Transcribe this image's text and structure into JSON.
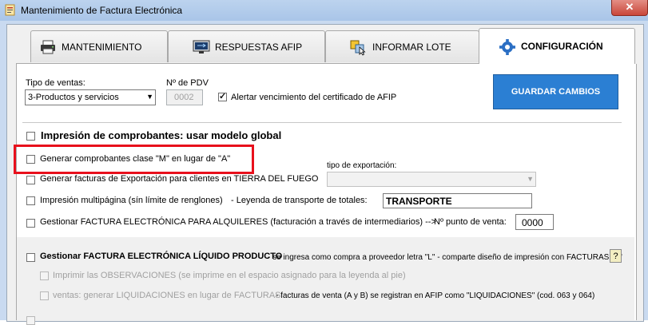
{
  "window": {
    "title": "Mantenimiento de Factura Electrónica",
    "close_label": "✕"
  },
  "tabs": [
    {
      "label": "MANTENIMIENTO",
      "icon": "printer-icon"
    },
    {
      "label": "RESPUESTAS AFIP",
      "icon": "monitor-icon"
    },
    {
      "label": "INFORMAR LOTE",
      "icon": "window-cursor-icon"
    },
    {
      "label": "CONFIGURACIÓN",
      "icon": "gear-icon",
      "active": true
    }
  ],
  "config": {
    "tipo_ventas_label": "Tipo de ventas:",
    "tipo_ventas_value": "3-Productos y servicios",
    "pdv_label": "Nº de PDV",
    "pdv_value": "0002",
    "alertar_label": "Alertar vencimiento del certificado de AFIP",
    "alertar_checked": true,
    "save_label": "GUARDAR CAMBIOS",
    "impresion_global_label": "Impresión de comprobantes: usar modelo global",
    "clase_m_label": "Generar comprobantes clase \"M\" en lugar de \"A\"",
    "exportacion_label": "Generar facturas de Exportación para clientes en TIERRA DEL FUEGO",
    "tipo_exportacion_label": "tipo de exportación:",
    "tipo_exportacion_value": "",
    "multipagina_label": "Impresión multipágina (sín límite de renglones)",
    "leyenda_label": "-  Leyenda de transporte de totales:",
    "leyenda_value": "TRANSPORTE",
    "alquileres_label": "Gestionar FACTURA ELECTRÓNICA PARA ALQUILERES (facturación a través de intermediarios)  -->",
    "punto_venta_label": "Nº punto de venta:",
    "punto_venta_value": "0000",
    "liquido_label": "Gestionar FACTURA ELECTRÓNICA LÍQUIDO PRODUCTO",
    "liquido_desc": "-  se ingresa como compra a proveedor letra \"L\" - comparte diseño de impresión con FACTURAS \"A\"",
    "help_label": "?",
    "observaciones_label": "Imprimir las OBSERVACIONES (se imprime en el espacio asignado para la leyenda al pie)",
    "liquidaciones_label": "ventas: generar LIQUIDACIONES en lugar de FACTURAS",
    "liquidaciones_desc": "-  facturas de venta (A y B) se registran en AFIP como \"LIQUIDACIONES\" (cod. 063 y 064)"
  },
  "colors": {
    "accent": "#2b7fd3",
    "highlight": "#e8101c"
  }
}
